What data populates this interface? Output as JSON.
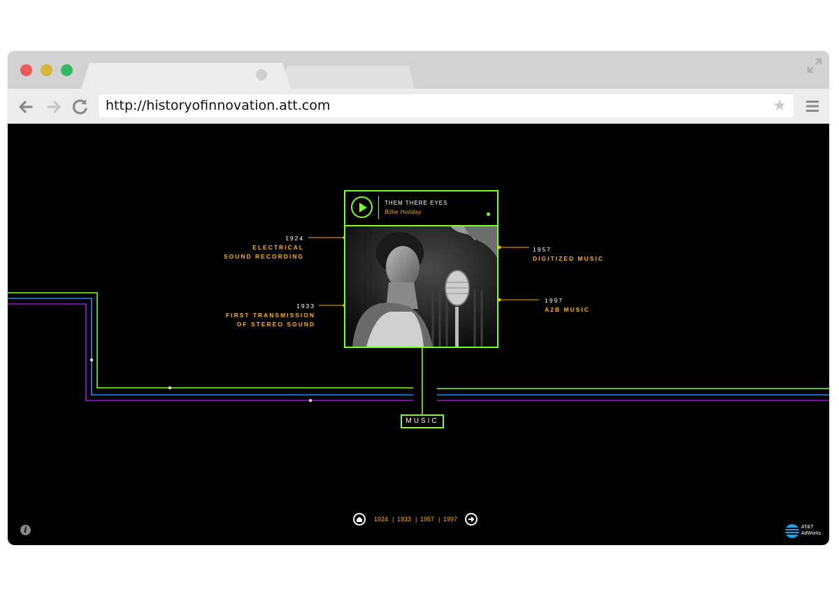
{
  "browser": {
    "url": "http://historyofinnovation.att.com",
    "star": "★"
  },
  "player": {
    "song_title": "THEM THERE EYES",
    "artist": "Billie Holiday"
  },
  "milestones": [
    {
      "year": "1924",
      "label_line1": "ELECTRICAL",
      "label_line2": "SOUND RECORDING"
    },
    {
      "year": "1933",
      "label_line1": "FIRST TRANSMISSION",
      "label_line2": "OF STEREO SOUND"
    },
    {
      "year": "1957",
      "label_line1": "DIGITIZED MUSIC",
      "label_line2": ""
    },
    {
      "year": "1997",
      "label_line1": "A2B MUSIC",
      "label_line2": ""
    }
  ],
  "category_label": "MUSIC",
  "timeline_nav": {
    "years": [
      "1924",
      "1933",
      "1957",
      "1997"
    ],
    "separator": "|"
  },
  "info_icon_text": "i",
  "brand": {
    "line1": "AT&T",
    "line2": "AdWorks"
  },
  "colors": {
    "accent_green": "#7dff2a",
    "accent_orange": "#ffb300",
    "line_blue": "#1e90ff",
    "line_purple": "#9b1bd6",
    "background": "#000000"
  }
}
